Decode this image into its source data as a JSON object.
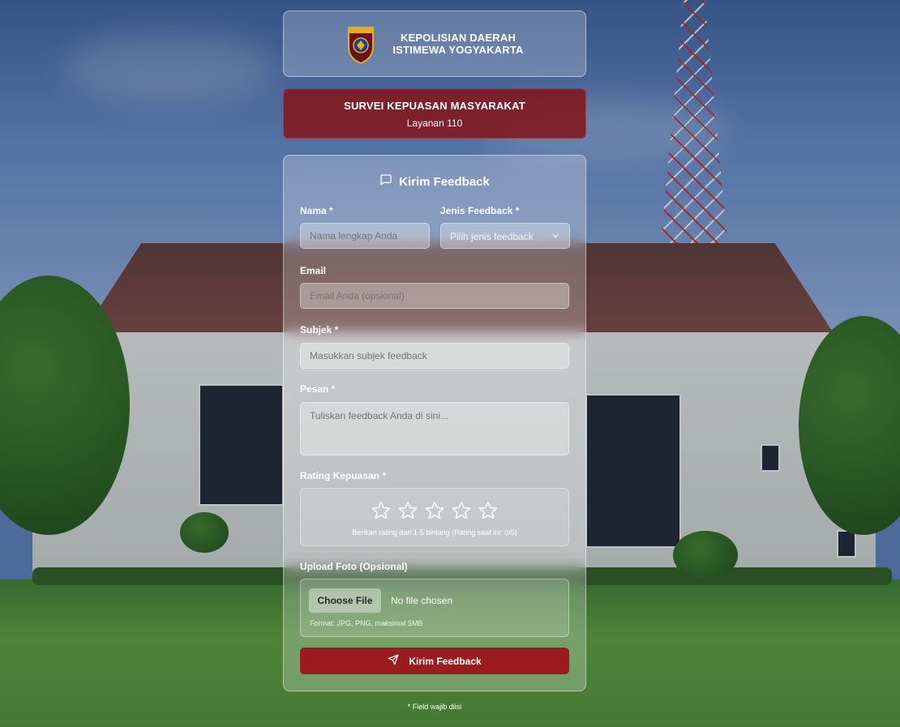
{
  "header": {
    "org_line1": "KEPOLISIAN DAERAH",
    "org_line2": "ISTIMEWA YOGYAKARTA",
    "badge_icon": "police-badge-icon"
  },
  "survey": {
    "title": "SURVEI KEPUASAN MASYARAKAT",
    "subtitle": "Layanan 110"
  },
  "form": {
    "title": "Kirim Feedback",
    "title_icon": "message-square-icon",
    "name": {
      "label": "Nama *",
      "placeholder": "Nama lengkap Anda",
      "value": ""
    },
    "feedback_type": {
      "label": "Jenis Feedback *",
      "selected": "Pilih jenis feedback"
    },
    "email": {
      "label": "Email",
      "placeholder": "Email Anda (opsional)",
      "value": ""
    },
    "subject": {
      "label": "Subjek *",
      "placeholder": "Masukkan subjek feedback",
      "value": ""
    },
    "message": {
      "label": "Pesan *",
      "placeholder": "Tuliskan feedback Anda di sini...",
      "value": ""
    },
    "rating": {
      "label": "Rating Kepuasan *",
      "max": 5,
      "current": 0,
      "hint": "Berikan rating dari 1-5 bintang (Rating saat ini: 0/5)"
    },
    "upload": {
      "label": "Upload Foto (Opsional)",
      "button": "Choose File",
      "status": "No file chosen",
      "hint": "Format: JPG, PNG, maksimal 5MB"
    },
    "submit": {
      "label": "Kirim Feedback",
      "icon": "send-icon"
    }
  },
  "footnote": "* Field wajib diisi",
  "colors": {
    "survey_banner": "#801a23",
    "submit_button": "#9b1c1f"
  }
}
